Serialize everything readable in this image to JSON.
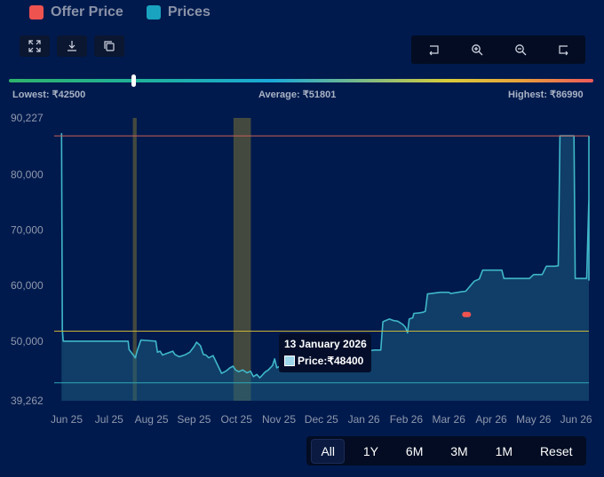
{
  "legend": [
    {
      "label": "Offer Price",
      "color": "#ef5350"
    },
    {
      "label": "Prices",
      "color": "#1aa3c0"
    }
  ],
  "toolbar": {
    "left": [
      "expand-icon",
      "download-icon",
      "copy-icon"
    ],
    "right": [
      "pan-left-icon",
      "zoom-in-icon",
      "zoom-out-icon",
      "pan-right-icon"
    ]
  },
  "stats": {
    "lowest": "Lowest: ₹42500",
    "average": "Average: ₹51801",
    "highest": "Highest: ₹86990"
  },
  "range_slider": {
    "handle_position": 0.21
  },
  "tooltip": {
    "date": "13 January 2026",
    "price": "Price:₹48400"
  },
  "periods": {
    "all": "All",
    "y1": "1Y",
    "m6": "6M",
    "m3": "3M",
    "m1": "1M",
    "reset": "Reset"
  },
  "chart_data": {
    "type": "area",
    "ylim": [
      39262,
      90227
    ],
    "y_ticks": [
      {
        "value": 90227,
        "label": "90,227"
      },
      {
        "value": 80000,
        "label": "80,000"
      },
      {
        "value": 70000,
        "label": "70,000"
      },
      {
        "value": 60000,
        "label": "60,000"
      },
      {
        "value": 50000,
        "label": "50,000"
      },
      {
        "value": 39262,
        "label": "39,262"
      }
    ],
    "xlim": [
      0,
      12.6
    ],
    "x_ticks": [
      {
        "value": 0,
        "label": "Jun 25"
      },
      {
        "value": 1,
        "label": "Jul 25"
      },
      {
        "value": 2,
        "label": "Aug 25"
      },
      {
        "value": 3,
        "label": "Sep 25"
      },
      {
        "value": 4,
        "label": "Oct 25"
      },
      {
        "value": 5,
        "label": "Nov 25"
      },
      {
        "value": 6,
        "label": "Dec 25"
      },
      {
        "value": 7,
        "label": "Jan 26"
      },
      {
        "value": 8,
        "label": "Feb 26"
      },
      {
        "value": 9,
        "label": "Mar 26"
      },
      {
        "value": 10,
        "label": "Apr 26"
      },
      {
        "value": 11,
        "label": "May 26"
      },
      {
        "value": 12,
        "label": "Jun 26"
      }
    ],
    "reference_lines": [
      {
        "value": 86990,
        "color": "#c9605a"
      },
      {
        "value": 51801,
        "color": "#c9b43a"
      },
      {
        "value": 42500,
        "color": "#2fa7b6"
      }
    ],
    "highlight_bands": [
      {
        "x0": 1.56,
        "x1": 1.65
      },
      {
        "x0": 3.93,
        "x1": 4.34
      }
    ],
    "offer_price": {
      "x": 9.42,
      "y": 54800,
      "color": "#ef5350"
    },
    "series": [
      {
        "name": "Prices",
        "color": "#3fb7c9",
        "points": [
          [
            -0.12,
            87500
          ],
          [
            -0.1,
            52000
          ],
          [
            -0.08,
            50000
          ],
          [
            1.45,
            50000
          ],
          [
            1.47,
            48500
          ],
          [
            1.62,
            47000
          ],
          [
            1.66,
            48200
          ],
          [
            1.75,
            50200
          ],
          [
            2.1,
            50000
          ],
          [
            2.14,
            48000
          ],
          [
            2.2,
            48200
          ],
          [
            2.26,
            47500
          ],
          [
            2.5,
            48200
          ],
          [
            2.55,
            47600
          ],
          [
            2.65,
            47200
          ],
          [
            2.78,
            47500
          ],
          [
            2.9,
            48000
          ],
          [
            3.0,
            49000
          ],
          [
            3.06,
            49800
          ],
          [
            3.15,
            49200
          ],
          [
            3.22,
            47600
          ],
          [
            3.28,
            47500
          ],
          [
            3.35,
            47000
          ],
          [
            3.45,
            47400
          ],
          [
            3.55,
            45800
          ],
          [
            3.65,
            44200
          ],
          [
            3.75,
            44600
          ],
          [
            3.85,
            45200
          ],
          [
            3.92,
            45500
          ],
          [
            3.98,
            44800
          ],
          [
            4.05,
            44500
          ],
          [
            4.15,
            44800
          ],
          [
            4.25,
            44300
          ],
          [
            4.33,
            44600
          ],
          [
            4.4,
            43600
          ],
          [
            4.48,
            44000
          ],
          [
            4.55,
            43400
          ],
          [
            4.6,
            43800
          ],
          [
            4.67,
            44400
          ],
          [
            4.75,
            44800
          ],
          [
            4.85,
            45600
          ],
          [
            4.9,
            46800
          ],
          [
            4.95,
            45200
          ],
          [
            5.05,
            45600
          ],
          [
            5.2,
            46600
          ],
          [
            5.3,
            46900
          ],
          [
            5.5,
            47000
          ],
          [
            5.9,
            47000
          ],
          [
            6.0,
            47200
          ],
          [
            6.5,
            47600
          ],
          [
            6.9,
            48000
          ],
          [
            7.05,
            48200
          ],
          [
            7.25,
            48400
          ],
          [
            7.4,
            48400
          ],
          [
            7.45,
            53500
          ],
          [
            7.6,
            54000
          ],
          [
            7.7,
            53700
          ],
          [
            7.8,
            53600
          ],
          [
            7.92,
            53000
          ],
          [
            7.98,
            52500
          ],
          [
            8.03,
            51500
          ],
          [
            8.07,
            54000
          ],
          [
            8.15,
            54200
          ],
          [
            8.18,
            55000
          ],
          [
            8.3,
            55100
          ],
          [
            8.4,
            55200
          ],
          [
            8.45,
            55400
          ],
          [
            8.5,
            58500
          ],
          [
            8.8,
            58800
          ],
          [
            9.0,
            58800
          ],
          [
            9.05,
            58600
          ],
          [
            9.3,
            58900
          ],
          [
            9.4,
            59000
          ],
          [
            9.6,
            60800
          ],
          [
            9.72,
            61200
          ],
          [
            9.8,
            62800
          ],
          [
            10.25,
            62800
          ],
          [
            10.3,
            61300
          ],
          [
            10.9,
            61300
          ],
          [
            11.0,
            62000
          ],
          [
            11.2,
            62000
          ],
          [
            11.3,
            63500
          ],
          [
            11.5,
            63500
          ],
          [
            11.58,
            63600
          ],
          [
            11.62,
            87000
          ],
          [
            11.95,
            87000
          ],
          [
            11.98,
            61300
          ],
          [
            12.25,
            61300
          ],
          [
            12.35,
            75800
          ],
          [
            12.5,
            61000
          ],
          [
            12.65,
            61300
          ],
          [
            12.9,
            62000
          ],
          [
            12.95,
            87000
          ],
          [
            13.05,
            87000
          ]
        ]
      }
    ]
  }
}
